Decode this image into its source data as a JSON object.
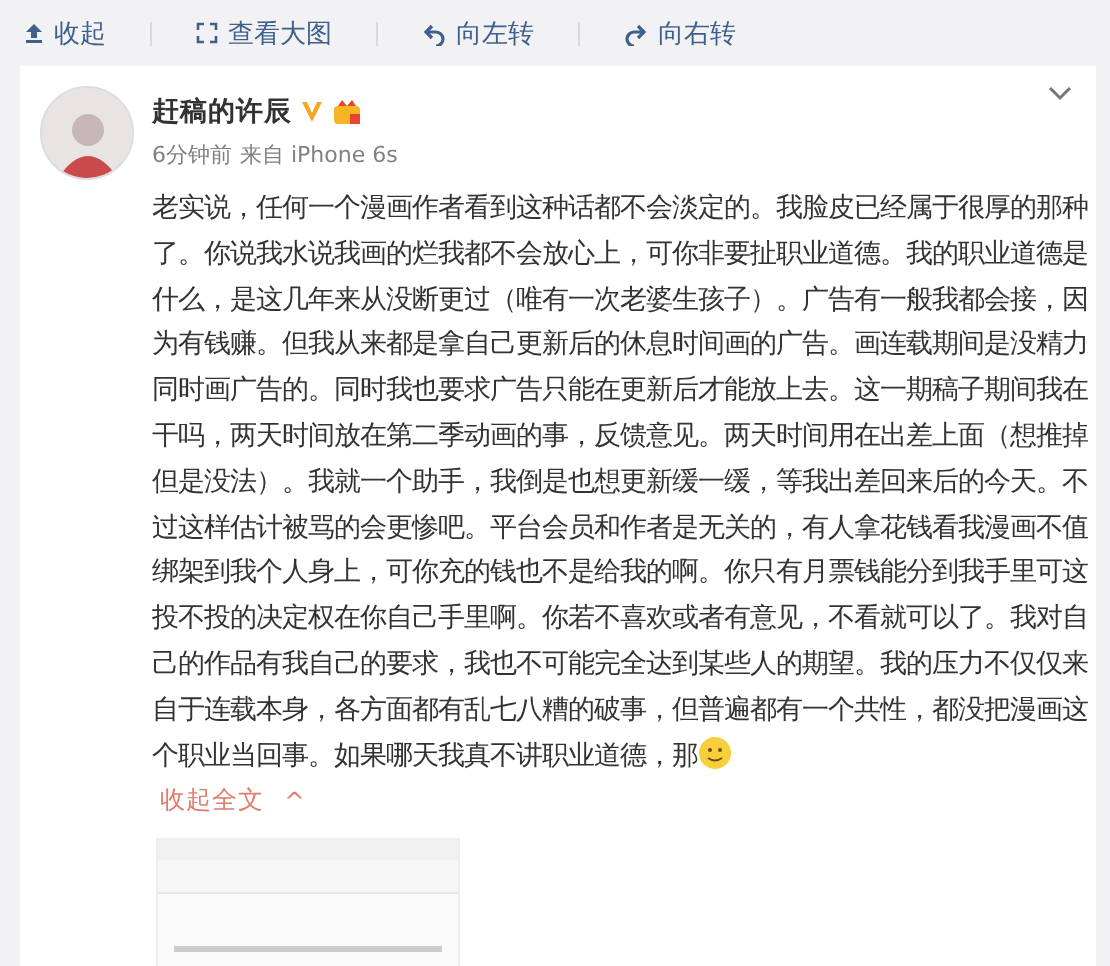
{
  "toolbar": [
    {
      "kind": "collapse",
      "label": "收起"
    },
    {
      "kind": "enlarge",
      "label": "查看大图"
    },
    {
      "kind": "rotate-left",
      "label": "向左转"
    },
    {
      "kind": "rotate-right",
      "label": "向右转"
    }
  ],
  "post": {
    "author": "赶稿的许辰",
    "verified": true,
    "vip": true,
    "time": "6分钟前",
    "source": "来自 iPhone 6s",
    "text": "老实说，任何一个漫画作者看到这种话都不会淡定的。我脸皮已经属于很厚的那种了。你说我水说我画的烂我都不会放心上，可你非要扯职业道德。我的职业道德是什么，是这几年来从没断更过（唯有一次老婆生孩子）。广告有一般我都会接，因为有钱赚。但我从来都是拿自己更新后的休息时间画的广告。画连载期间是没精力同时画广告的。同时我也要求广告只能在更新后才能放上去。这一期稿子期间我在干吗，两天时间放在第二季动画的事，反馈意见。两天时间用在出差上面（想推掉但是没法）。我就一个助手，我倒是也想更新缓一缓，等我出差回来后的今天。不过这样估计被骂的会更惨吧。平台会员和作者是无关的，有人拿花钱看我漫画不值绑架到我个人身上，可你充的钱也不是给我的啊。你只有月票钱能分到我手里可这投不投的决定权在你自己手里啊。你若不喜欢或者有意见，不看就可以了。我对自己的作品有我自己的要求，我也不可能完全达到某些人的期望。我的压力不仅仅来自于连载本身，各方面都有乱七八糟的破事，但普遍都有一个共性，都没把漫画这个职业当回事。如果哪天我真不讲职业道德，那",
    "ends_with_emoji": true,
    "collapse_link": "收起全文",
    "collapse_caret": "^"
  }
}
